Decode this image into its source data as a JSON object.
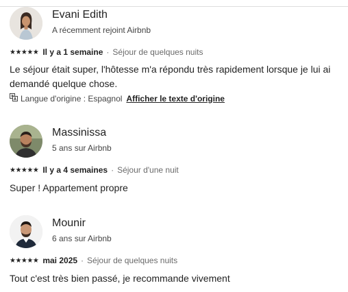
{
  "reviews": [
    {
      "name": "Evani Edith",
      "subtitle": "A récemment rejoint Airbnb",
      "stars": "★★★★★",
      "when": "Il y a 1 semaine",
      "stay": "Séjour de quelques nuits",
      "text": "Le séjour était super, l'hôtesse m'a répondu très rapidement lorsque je lui ai demandé quelque chose.",
      "language_note": "Langue d'origine : Espagnol",
      "show_original": "Afficher le texte d'origine"
    },
    {
      "name": "Massinissa",
      "subtitle": "5 ans sur Airbnb",
      "stars": "★★★★★",
      "when": "Il y a 4 semaines",
      "stay": "Séjour d'une nuit",
      "text": "Super ! Appartement propre"
    },
    {
      "name": "Mounir",
      "subtitle": "6 ans sur Airbnb",
      "stars": "★★★★★",
      "when": "mai 2025",
      "stay": "Séjour de quelques nuits",
      "text": "Tout c'est très bien passé, je recommande vivement"
    }
  ],
  "separator": "·",
  "icons": {
    "avatar": "avatar-photo",
    "star": "star-icon",
    "translate": "translate-icon"
  }
}
